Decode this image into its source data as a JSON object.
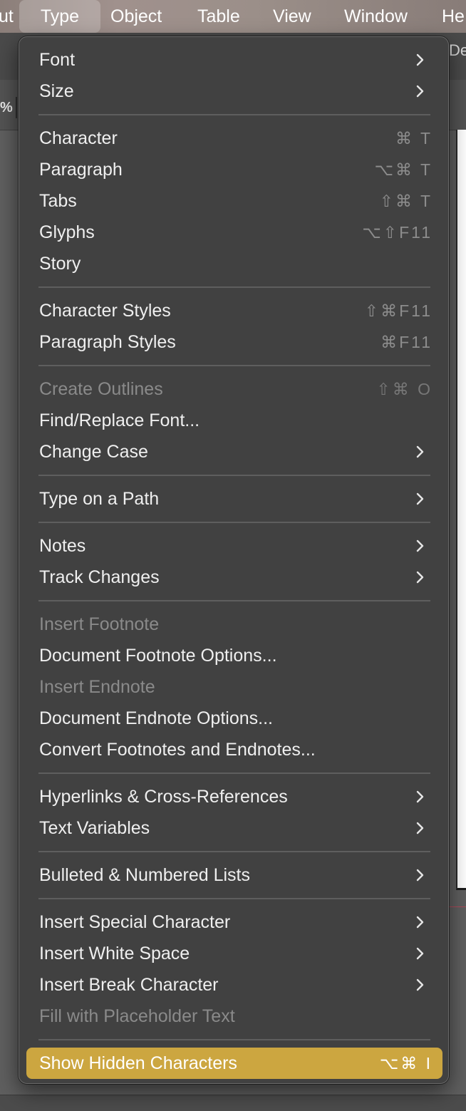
{
  "menubar": {
    "items": [
      {
        "label": "ut",
        "active": false
      },
      {
        "label": "Type",
        "active": true
      },
      {
        "label": "Object",
        "active": false
      },
      {
        "label": "Table",
        "active": false
      },
      {
        "label": "View",
        "active": false
      },
      {
        "label": "Window",
        "active": false
      },
      {
        "label": "He",
        "active": false
      }
    ]
  },
  "background": {
    "toolbar_label": "De",
    "zoom_label": "%"
  },
  "menu": {
    "title": "Type",
    "highlight_color": "#cca640",
    "sections": [
      [
        {
          "label": "Font",
          "submenu": true
        },
        {
          "label": "Size",
          "submenu": true
        }
      ],
      [
        {
          "label": "Character",
          "shortcut": "⌘ T"
        },
        {
          "label": "Paragraph",
          "shortcut": "⌥⌘ T"
        },
        {
          "label": "Tabs",
          "shortcut": "⇧⌘ T"
        },
        {
          "label": "Glyphs",
          "shortcut": "⌥⇧F11"
        },
        {
          "label": "Story"
        }
      ],
      [
        {
          "label": "Character Styles",
          "shortcut": "⇧⌘F11"
        },
        {
          "label": "Paragraph Styles",
          "shortcut": "⌘F11"
        }
      ],
      [
        {
          "label": "Create Outlines",
          "shortcut": "⇧⌘ O",
          "disabled": true
        },
        {
          "label": "Find/Replace Font..."
        },
        {
          "label": "Change Case",
          "submenu": true
        }
      ],
      [
        {
          "label": "Type on a Path",
          "submenu": true
        }
      ],
      [
        {
          "label": "Notes",
          "submenu": true
        },
        {
          "label": "Track Changes",
          "submenu": true
        }
      ],
      [
        {
          "label": "Insert Footnote",
          "disabled": true
        },
        {
          "label": "Document Footnote Options..."
        },
        {
          "label": "Insert Endnote",
          "disabled": true
        },
        {
          "label": "Document Endnote Options..."
        },
        {
          "label": "Convert Footnotes and Endnotes..."
        }
      ],
      [
        {
          "label": "Hyperlinks & Cross-References",
          "submenu": true
        },
        {
          "label": "Text Variables",
          "submenu": true
        }
      ],
      [
        {
          "label": "Bulleted & Numbered Lists",
          "submenu": true
        }
      ],
      [
        {
          "label": "Insert Special Character",
          "submenu": true
        },
        {
          "label": "Insert White Space",
          "submenu": true
        },
        {
          "label": "Insert Break Character",
          "submenu": true
        },
        {
          "label": "Fill with Placeholder Text",
          "disabled": true
        }
      ],
      [
        {
          "label": "Show Hidden Characters",
          "shortcut": "⌥⌘ I",
          "highlighted": true
        }
      ]
    ]
  }
}
